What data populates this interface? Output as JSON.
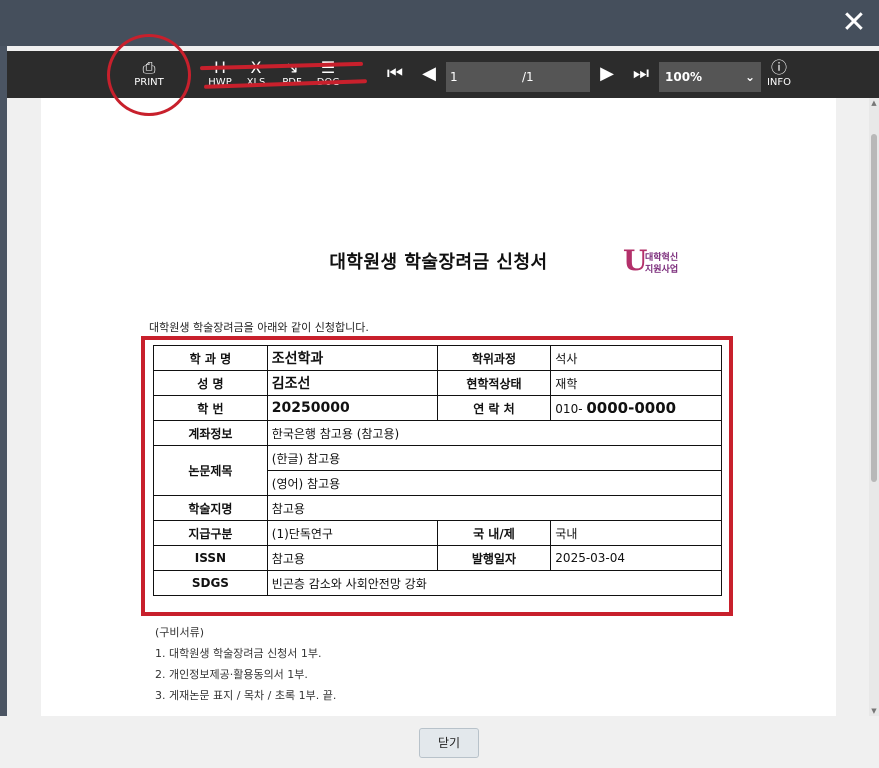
{
  "modal": {
    "close_icon": "close-icon"
  },
  "toolbar": {
    "print_label": "PRINT",
    "hwp_label": "HWP",
    "xls_label": "XLS",
    "pdf_label": "PDF",
    "doc_label": "DOC",
    "page_current": "1",
    "page_total": "/1",
    "zoom": "100%",
    "info_label": "INFO"
  },
  "document": {
    "title": "대학원생 학술장려금 신청서",
    "logo_line1": "대학혁신",
    "logo_line2": "지원사업",
    "intro": "대학원생 학술장려금을 아래와 같이 신청합니다.",
    "rows": {
      "dept_label": "학 과 명",
      "dept_value": "조선학과",
      "degree_label": "학위과정",
      "degree_value": "석사",
      "name_label": "성 명",
      "name_value": "김조선",
      "status_label": "현학적상태",
      "status_value": "재학",
      "id_label": "학 번",
      "id_value": "20250000",
      "contact_label": "연 락 처",
      "contact_prefix": "010-",
      "contact_value": "0000-0000",
      "account_label": "계좌정보",
      "account_value": "한국은행 참고용 (참고용)",
      "thesis_label": "논문제목",
      "thesis_ko": "(한글) 참고용",
      "thesis_en": "(영어) 참고용",
      "journal_label": "학술지명",
      "journal_value": "참고용",
      "type_label": "지급구분",
      "type_value": "(1)단독연구",
      "country_label": "국 내/제",
      "country_value": "국내",
      "issn_label": "ISSN",
      "issn_value": "참고용",
      "date_label": "발행일자",
      "date_value": "2025-03-04",
      "sdgs_label": "SDGS",
      "sdgs_value": "빈곤층 감소와 사회안전망 강화"
    },
    "docs_header": "(구비서류)",
    "docs": [
      "1. 대학원생 학술장려금 신청서 1부.",
      "2. 개인정보제공·활용동의서 1부.",
      "3. 게재논문 표지 / 목차 / 초록 1부.  끝."
    ]
  },
  "footer": {
    "close_label": "닫기"
  }
}
